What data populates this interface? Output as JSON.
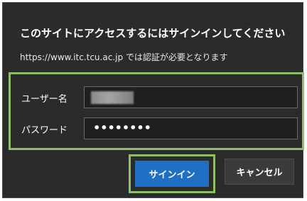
{
  "dialog": {
    "title": "このサイトにアクセスするにはサインインしてください",
    "subtitle": "https://www.itc.tcu.ac.jp では認証が必要となります"
  },
  "fields": {
    "username_label": "ユーザー名",
    "password_label": "パスワード",
    "password_mask": "••••••••"
  },
  "buttons": {
    "sign_in": "サインイン",
    "cancel": "キャンセル"
  },
  "colors": {
    "dialog_bg": "#2b2b2b",
    "accent": "#1f6fc5",
    "highlight": "#8fbf6a"
  }
}
